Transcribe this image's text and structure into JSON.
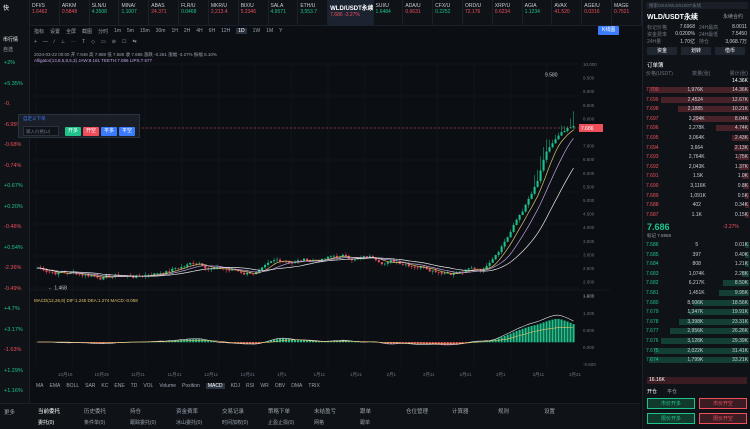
{
  "leftbar": {
    "title": "快",
    "items": [
      "币行情",
      "自选",
      "资产"
    ],
    "pct": [
      {
        "v": "+2%",
        "c": "up"
      },
      {
        "v": "+5.35%",
        "c": "up"
      },
      {
        "v": "-0.",
        "c": "dn"
      },
      {
        "v": "-6.95%",
        "c": "dn"
      },
      {
        "v": "-0.68%",
        "c": "dn"
      },
      {
        "v": "-0.74%",
        "c": "dn"
      },
      {
        "v": "+0.67%",
        "c": "up"
      },
      {
        "v": "+0.20%",
        "c": "up"
      },
      {
        "v": "-0.46%",
        "c": "dn"
      },
      {
        "v": "+0.54%",
        "c": "up"
      },
      {
        "v": "-2.36%",
        "c": "dn"
      },
      {
        "v": "-0.49%",
        "c": "dn"
      },
      {
        "v": "+4.7%",
        "c": "up"
      },
      {
        "v": "+3.17%",
        "c": "up"
      },
      {
        "v": "-1.63%",
        "c": "dn"
      },
      {
        "v": "+1.29%",
        "c": "up"
      },
      {
        "v": "+1.16%",
        "c": "up"
      }
    ]
  },
  "ticker": [
    {
      "n": "DFI/S",
      "p": "1.6462",
      "c": "dn"
    },
    {
      "n": "ARKM",
      "p": "0.5848",
      "c": "dn"
    },
    {
      "n": "SLN/U",
      "p": "4.3508",
      "c": "up"
    },
    {
      "n": "MINA/",
      "p": "1.1007",
      "c": "up"
    },
    {
      "n": "ABAS",
      "p": "24.371",
      "c": "dn"
    },
    {
      "n": "FLR/U",
      "p": "0.0468",
      "c": "up"
    },
    {
      "n": "MKR/U",
      "p": "2,213.4",
      "c": "dn"
    },
    {
      "n": "BIX/U",
      "p": "5.2346",
      "c": "dn"
    },
    {
      "n": "SALA",
      "p": "4.9571",
      "c": "up"
    },
    {
      "n": "ETH/U",
      "p": "3,553.7",
      "c": "up"
    },
    {
      "n": "WLD/USDT永续",
      "p": "7,686  -3.27%",
      "c": "dn",
      "active": true
    },
    {
      "n": "SUI/U",
      "p": "1.6484",
      "c": "up"
    },
    {
      "n": "ADA/U",
      "p": "0.6631",
      "c": "dn"
    },
    {
      "n": "CFX/U",
      "p": "0.2252",
      "c": "up"
    },
    {
      "n": "ORD/U",
      "p": "72.176",
      "c": "dn"
    },
    {
      "n": "XRP/U",
      "p": "0.6234",
      "c": "dn"
    },
    {
      "n": "AGIA",
      "p": "1.1234",
      "c": "up"
    },
    {
      "n": "AVAX",
      "p": "41.520",
      "c": "dn"
    },
    {
      "n": "AGE/U",
      "p": "0.0316",
      "c": "dn"
    },
    {
      "n": "MAGE",
      "p": "0.7521",
      "c": "dn"
    }
  ],
  "toolbar": {
    "items": [
      "指标",
      "设置",
      "全屏",
      "截图",
      "分时",
      "1m",
      "5m",
      "15m",
      "30m",
      "1H",
      "2H",
      "4H",
      "6H",
      "12H",
      "1D",
      "1W",
      "1M",
      "Y"
    ],
    "selected": "1D",
    "right_btn": "K线图",
    "items2": [
      "+",
      "—",
      "∕",
      "⊥",
      "⋯",
      "T",
      "◇",
      "▭",
      "⊘",
      "☐",
      "⇆"
    ]
  },
  "chart_info": {
    "line1": "2024-03-22 00:00  开 7.948  高 7.988  低 7.580  收 7.686  涨跌 -0.261  涨幅 -3.27%  振幅 5.10%",
    "line2": "Alligator(13,8,5,8,5,3)  JAW:8.161  TEETH:7.086  LIPS:7.677",
    "macd_label": "MACD(12,26,9)  DIF:1.245  DEA:1.274  MACD:-0.058"
  },
  "price_axis": [
    "10.000",
    "9.500",
    "9.000",
    "8.500",
    "8.000",
    "7.686",
    "7.000",
    "6.500",
    "6.000",
    "5.500",
    "5.000",
    "4.500",
    "4.000",
    "3.500",
    "3.000",
    "2.500",
    "2.000",
    "1.500"
  ],
  "macd_axis": [
    "1.800",
    "1.200",
    "0.600",
    "0.000",
    "-0.600"
  ],
  "date_axis": [
    "10月16",
    "10月26",
    "11月11",
    "11月21",
    "12月11",
    "12月21",
    "1月1",
    "1月11",
    "1月21",
    "2月1",
    "2月11",
    "2月21",
    "3月1",
    "3月11",
    "3月21"
  ],
  "high_label": "9.580",
  "low_label": "1.468",
  "last_price_tag": "7.686",
  "order_widget": {
    "title": "自定义下单",
    "placeholder": "输入价格(U)",
    "buttons": [
      "开多",
      "开空",
      "平多",
      "平空"
    ]
  },
  "indicator_tabs": [
    "MA",
    "EMA",
    "BOLL",
    "SAR",
    "KC",
    "ENE",
    "TD",
    "VOL",
    "Volume",
    "Position",
    "MACD",
    "KDJ",
    "RSI",
    "WR",
    "OBV",
    "DMA",
    "TRIX"
  ],
  "bottom": {
    "tabs": [
      "当前委托",
      "历史委托",
      "持仓",
      "资金费率",
      "交易记录",
      "策略下单",
      "未结盈亏",
      "跟单",
      "仓位管理",
      "计算器",
      "规则",
      "设置"
    ],
    "row2": [
      "委托(0)",
      "条件单(0)",
      "跟踪委托(0)",
      "冰山委托(0)",
      "时间加权(0)",
      "止盈止损(0)",
      "网格",
      "跟单"
    ],
    "left_label": "更多"
  },
  "right": {
    "search_placeholder": "搜索OKX/WLD/USDT永续",
    "pair": "WLD/USDT永续",
    "subpair": "永续合约",
    "stats": [
      {
        "k": "标记价格",
        "v": "7.6968"
      },
      {
        "k": "24H最高",
        "v": "8.0011"
      },
      {
        "k": "资金费率",
        "v": "0.0200%"
      },
      {
        "k": "24H最低",
        "v": "7.5450"
      },
      {
        "k": "24H量",
        "v": "1.70亿"
      },
      {
        "k": "持仓",
        "v": "3,068.7万"
      }
    ],
    "buttons": [
      "资金",
      "划转",
      "借币"
    ],
    "book_title": "订单簿",
    "book_cols": [
      "价格(USDT)",
      "数量(张)",
      "累计(张)"
    ],
    "spread_top": "14.36K",
    "asks": [
      [
        "7.700",
        "1,976K",
        "14.36K"
      ],
      [
        "7.699",
        "2,4524",
        "12.67K"
      ],
      [
        "7.698",
        "2,1885",
        "10.21K"
      ],
      [
        "7.697",
        "3,294K",
        "8.04K"
      ],
      [
        "7.696",
        "2,278K",
        "4.74K"
      ],
      [
        "7.695",
        "3,064K",
        "2.43K"
      ],
      [
        "7.694",
        "3,664",
        "2.13K"
      ],
      [
        "7.693",
        "2,764K",
        "1.75K"
      ],
      [
        "7.692",
        "2,043K",
        "1.37K"
      ],
      [
        "7.691",
        "1.5K",
        "1.0K"
      ],
      [
        "7.690",
        "3,116K",
        "0.8K"
      ],
      [
        "7.689",
        "1,091K",
        "0.5K"
      ],
      [
        "7.688",
        "402",
        "0.34K"
      ],
      [
        "7.687",
        "1.1K",
        "0.15K"
      ]
    ],
    "last_price": "7.686",
    "last_change": "-3.27%",
    "mark_label": "标记 7.6968",
    "bids": [
      [
        "7.686",
        "5",
        "0.01K"
      ],
      [
        "7.685",
        "397",
        "0.40K"
      ],
      [
        "7.684",
        "808",
        "1.21K"
      ],
      [
        "7.683",
        "1,074K",
        "2.28K"
      ],
      [
        "7.682",
        "6,217K",
        "8.50K"
      ],
      [
        "7.681",
        "1,451K",
        "9.95K"
      ],
      [
        "7.680",
        "8,606K",
        "18.56K"
      ],
      [
        "7.679",
        "1,347K",
        "19.91K"
      ],
      [
        "7.678",
        "3,398K",
        "23.31K"
      ],
      [
        "7.677",
        "2,956K",
        "26.26K"
      ],
      [
        "7.676",
        "3,128K",
        "29.39K"
      ],
      [
        "7.675",
        "2,022K",
        "31.41K"
      ],
      [
        "7.674",
        "1,799K",
        "33.21K"
      ]
    ],
    "bottom_total": "16.16K",
    "trade_tabs": [
      "开仓",
      "平仓"
    ],
    "trade_btns": [
      "市价开多",
      "市价开空",
      "限价开多",
      "限价开空"
    ],
    "colors": {
      "up": "#1fc28a",
      "down": "#ef4f5b",
      "accent": "#3b7cff"
    }
  }
}
